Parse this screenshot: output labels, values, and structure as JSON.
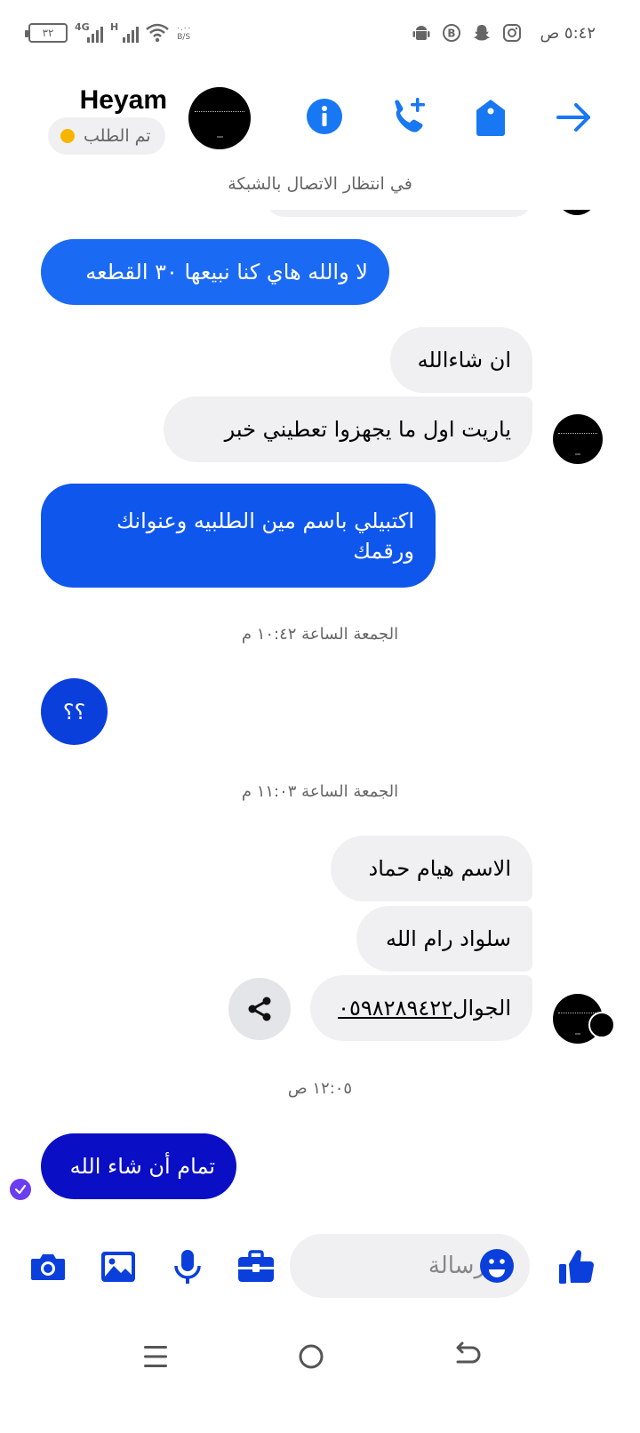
{
  "status_bar": {
    "time": "٥:٤٢ ص",
    "battery": "٣٢",
    "network_1": "4G",
    "network_2": "H",
    "speed_value": "٠.٠٠",
    "speed_unit": "B/S",
    "icons": [
      "android-icon",
      "bitcoin-icon",
      "snapchat-icon",
      "instagram-icon"
    ]
  },
  "header": {
    "contact_name": "Heyam",
    "status_text": "تم الطلب",
    "status_color": "#f7b500",
    "actions": [
      "info-icon",
      "add-call-icon",
      "tag-icon",
      "forward-arrow-icon"
    ],
    "accent_color": "#1877f2"
  },
  "network_note": "في انتظار الاتصال بالشبكة",
  "messages": {
    "m1": "لا والله هاي كنا نبيعها ٣٠ القطعه",
    "m2": "ان شاءالله",
    "m3": "ياريت اول ما يجهزوا تعطيني خبر",
    "m4_line1": "اكتبيلي باسم مين الطلبيه وعنوانك",
    "m4_line2": "ورقمك",
    "ts1": "الجمعة الساعة ١٠:٤٢ م",
    "m5": "؟؟",
    "ts2": "الجمعة الساعة ١١:٠٣ م",
    "m6": "الاسم هيام حماد",
    "m7": "سلواد رام الله",
    "m8_label": "الجوال",
    "m8_number": "٠٥٩٨٢٨٩٤٢٢",
    "ts3": "١٢:٠٥ ص",
    "m9": "تمام أن شاء الله"
  },
  "composer": {
    "placeholder": "رسالة",
    "icons": [
      "camera-icon",
      "gallery-icon",
      "microphone-icon",
      "briefcase-icon",
      "emoji-icon",
      "thumbs-up-icon"
    ]
  },
  "nav": [
    "menu-icon",
    "home-icon",
    "back-icon"
  ]
}
